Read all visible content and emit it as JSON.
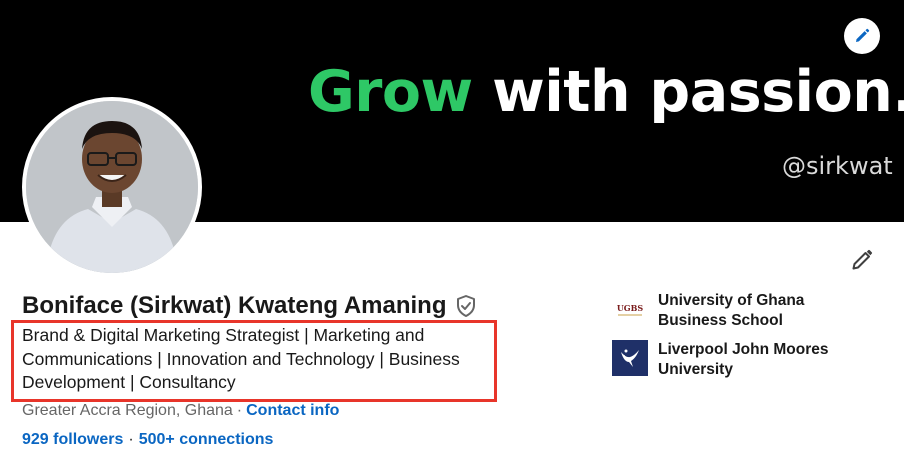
{
  "colors": {
    "accent-green": "#2ec866",
    "link-blue": "#0a66c2",
    "highlight-red": "#e8352a",
    "ljmu-navy": "#1f3068"
  },
  "banner": {
    "tagline_green": "Grow",
    "tagline_white": " with passion.",
    "handle": "@sirkwat",
    "edit_icon": "pencil-icon"
  },
  "profile": {
    "name": "Boniface (Sirkwat) Kwateng Amaning",
    "verified_icon": "shield-check-icon",
    "headline": "Brand & Digital Marketing Strategist | Marketing and Communications | Innovation and Technology | Business Development | Consultancy",
    "location": "Greater Accra Region, Ghana",
    "separator": "·",
    "contact_info": "Contact info",
    "followers": "929 followers",
    "connections_sep": "·",
    "connections": "500+ connections"
  },
  "education": [
    {
      "name": "University of Ghana Business School",
      "logo_text": "UGBS",
      "icon": "ugbs-logo"
    },
    {
      "name": "Liverpool John Moores University",
      "icon": "ljmu-logo"
    }
  ]
}
